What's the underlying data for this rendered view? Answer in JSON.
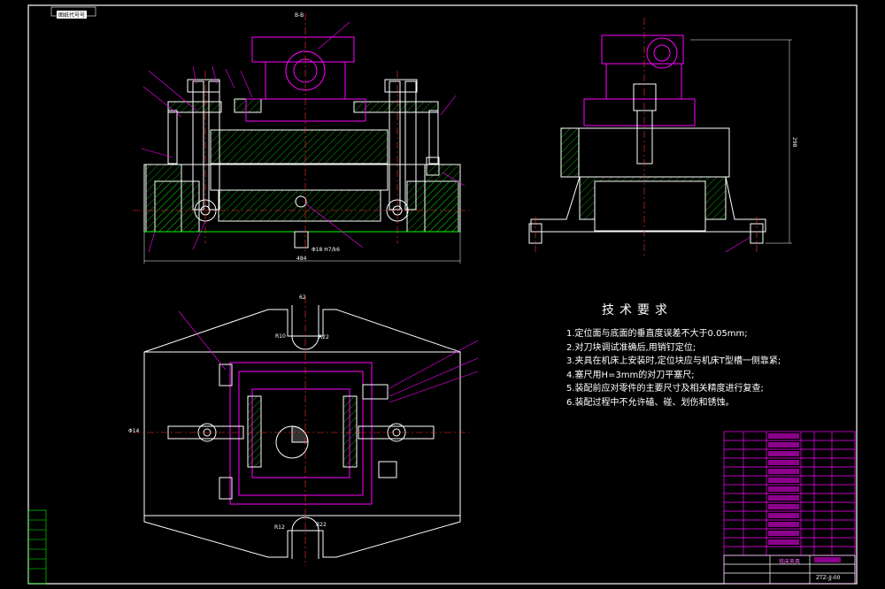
{
  "drawing": {
    "stamp": "图纸代号号",
    "dimension_width": "484",
    "dimension_height": "298",
    "dimension_top": "62",
    "dimension_r_top_left": "R10",
    "dimension_r_top_right": "R22",
    "dimension_r_bot_left": "R12",
    "dimension_r_bot_right": "R22",
    "section_label": "B-B",
    "fit_label": "Φ18 H7/k6",
    "fit_label_2": "Φ14"
  },
  "tech_requirements": {
    "title": "技术要求",
    "lines": [
      "1.定位面与底面的垂直度误差不大于0.05mm;",
      "2.对刀块调试准确后,用销钉定位;",
      "3.夹具在机床上安装时,定位块应与机床T型槽一侧靠紧;",
      "4.塞尺用H=3mm的对刀平塞尺;",
      "5.装配前应对零件的主要尺寸及相关精度进行复查;",
      "6.装配过程中不允许磕、碰、划伤和锈蚀。"
    ]
  },
  "title_block": {
    "drawing_no": "ZTZ-JJ-00",
    "name": "铣床夹具"
  },
  "colors": {
    "background": "#000000",
    "border": "#ffffff",
    "part": "#ffffff",
    "hatch": "#00ff00",
    "center": "#ff0000",
    "leader": "#ff00ff",
    "table": "#ff00ff",
    "dim": "#ffffff"
  }
}
